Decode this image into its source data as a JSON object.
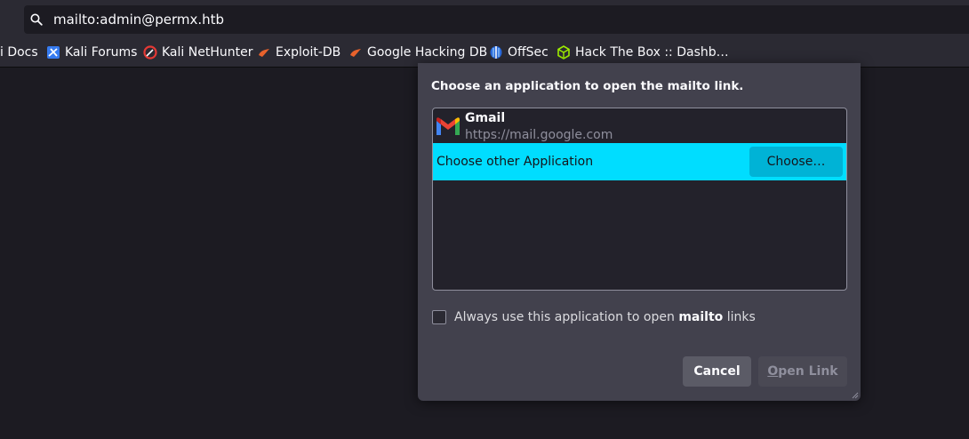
{
  "urlbar": {
    "value": "mailto:admin@permx.htb",
    "icon": "search-icon"
  },
  "bookmarks": [
    {
      "label": "i Docs",
      "icon": ""
    },
    {
      "label": "Kali Forums",
      "icon": "kali-forums-icon"
    },
    {
      "label": "Kali NetHunter",
      "icon": "kali-nethunter-icon"
    },
    {
      "label": "Exploit-DB",
      "icon": "exploit-db-icon"
    },
    {
      "label": "Google Hacking DB",
      "icon": "ghdb-icon"
    },
    {
      "label": "OffSec",
      "icon": "offsec-icon"
    },
    {
      "label": "Hack The Box :: Dashb…",
      "icon": "htb-icon"
    }
  ],
  "dialog": {
    "heading": "Choose an application to open the mailto link.",
    "apps": [
      {
        "name": "Gmail",
        "url": "https://mail.google.com",
        "icon": "gmail-icon"
      }
    ],
    "choose_other_label": "Choose other Application",
    "choose_button": "Choose…",
    "always_prefix": "Always use this application to open ",
    "always_bold": "mailto",
    "always_suffix": " links",
    "always_checked": false,
    "cancel": "Cancel",
    "open_link_first": "O",
    "open_link_rest": "pen Link"
  },
  "colors": {
    "highlight": "#00ddff",
    "dialog_bg": "#42414d",
    "page_bg": "#1c1b22"
  }
}
